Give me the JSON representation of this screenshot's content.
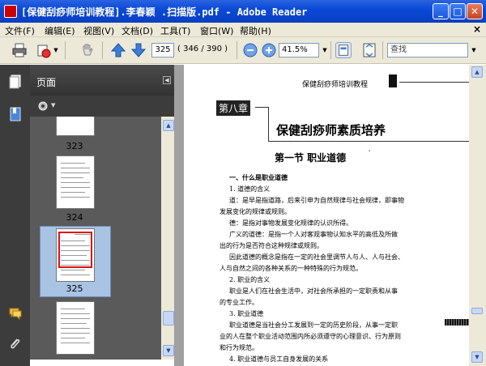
{
  "window": {
    "title": "[保健刮痧师培训教程].李春颖 .扫描版.pdf - Adobe Reader",
    "minimize": "_",
    "maximize": "□",
    "close": "✕"
  },
  "menu": {
    "items": [
      "文件(F)",
      "编辑(E)",
      "视图(V)",
      "文档(D)",
      "工具(T)",
      "窗口(W)",
      "帮助(H)"
    ],
    "doc_close": "×"
  },
  "toolbar": {
    "page_current": "325",
    "page_count": "( 346 / 390 )",
    "zoom": "41.5%",
    "search_placeholder": "查找"
  },
  "pages_panel": {
    "title": "页面",
    "thumbnails": [
      {
        "label": "323"
      },
      {
        "label": "324"
      },
      {
        "label": "325",
        "selected": true
      }
    ]
  },
  "document": {
    "header_text": "保健刮痧师培训教程",
    "chapter_tag": "第八章",
    "chapter_title": "保健刮痧师素质培养",
    "section_title": "第一节 职业道德",
    "section_mark": "'",
    "lines": [
      "一、什么是职业道德",
      "1. 道德的含义",
      "道：是早是指道路，后来引申为自然规律与社会规律，即事物",
      "发展变化的规律或规则。",
      "德：是指对事物发展变化规律的认识所得。",
      "广义的道德：是指一个人对客观事物认知水平的高低及所做",
      "出的行为是否符合这种规律或规则。",
      "因此道德的概念是指在一定的社会里调节人与人、人与社会、",
      "人与自然之间的各种关系的一种特殊的行为规范。",
      "2. 职业的含义",
      "职业是人们在社会生活中，对社会所承担的一定职责和从事",
      "的专业工作。",
      "3. 职业道德",
      "职业道德是当社会分工发展到一定的历史阶段，从事一定职",
      "业的人在整个职业活动范围内所必须遵守的心理意识、行为原则",
      "和行为规范。",
      "4. 职业道德与员工自身发展的关系"
    ]
  }
}
